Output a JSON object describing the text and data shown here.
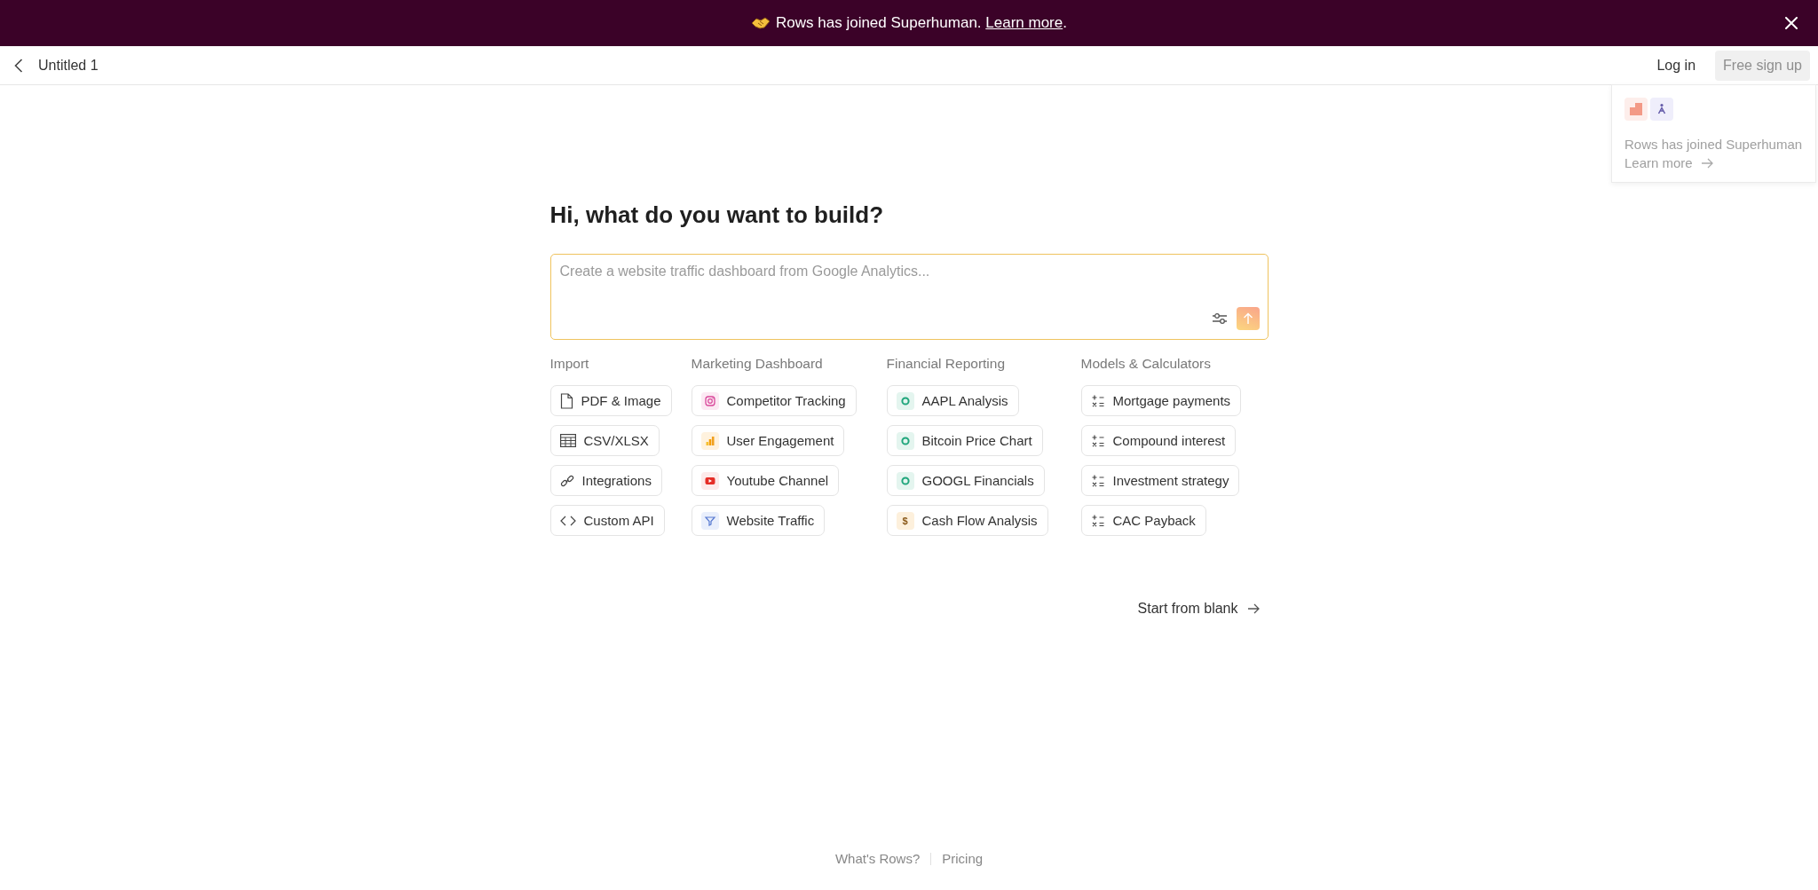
{
  "banner": {
    "message": "Rows has joined Superhuman.",
    "link": "Learn more",
    "suffix": "."
  },
  "header": {
    "title": "Untitled 1",
    "login": "Log in",
    "signup": {
      "label": "Free sign up",
      "disabled": true
    }
  },
  "popover": {
    "message": "Rows has joined Superhuman",
    "link": "Learn more"
  },
  "heading": "Hi, what do you want to build?",
  "prompt": {
    "placeholder": "Create a website traffic dashboard from Google Analytics..."
  },
  "categories": [
    {
      "title": "Import",
      "items": [
        {
          "label": "PDF & Image"
        },
        {
          "label": "CSV/XLSX"
        },
        {
          "label": "Integrations"
        },
        {
          "label": "Custom API"
        }
      ]
    },
    {
      "title": "Marketing Dashboard",
      "items": [
        {
          "label": "Competitor Tracking"
        },
        {
          "label": "User Engagement"
        },
        {
          "label": "Youtube Channel"
        },
        {
          "label": "Website Traffic"
        }
      ]
    },
    {
      "title": "Financial Reporting",
      "items": [
        {
          "label": "AAPL Analysis"
        },
        {
          "label": "Bitcoin Price Chart"
        },
        {
          "label": "GOOGL Financials"
        },
        {
          "label": "Cash Flow Analysis",
          "badge": "$"
        }
      ]
    },
    {
      "title": "Models & Calculators",
      "items": [
        {
          "label": "Mortgage payments"
        },
        {
          "label": "Compound interest"
        },
        {
          "label": "Investment strategy"
        },
        {
          "label": "CAC Payback"
        }
      ]
    }
  ],
  "start_blank": {
    "label": "Start from blank"
  },
  "footer": {
    "links": [
      "What's Rows?",
      "Pricing"
    ]
  }
}
